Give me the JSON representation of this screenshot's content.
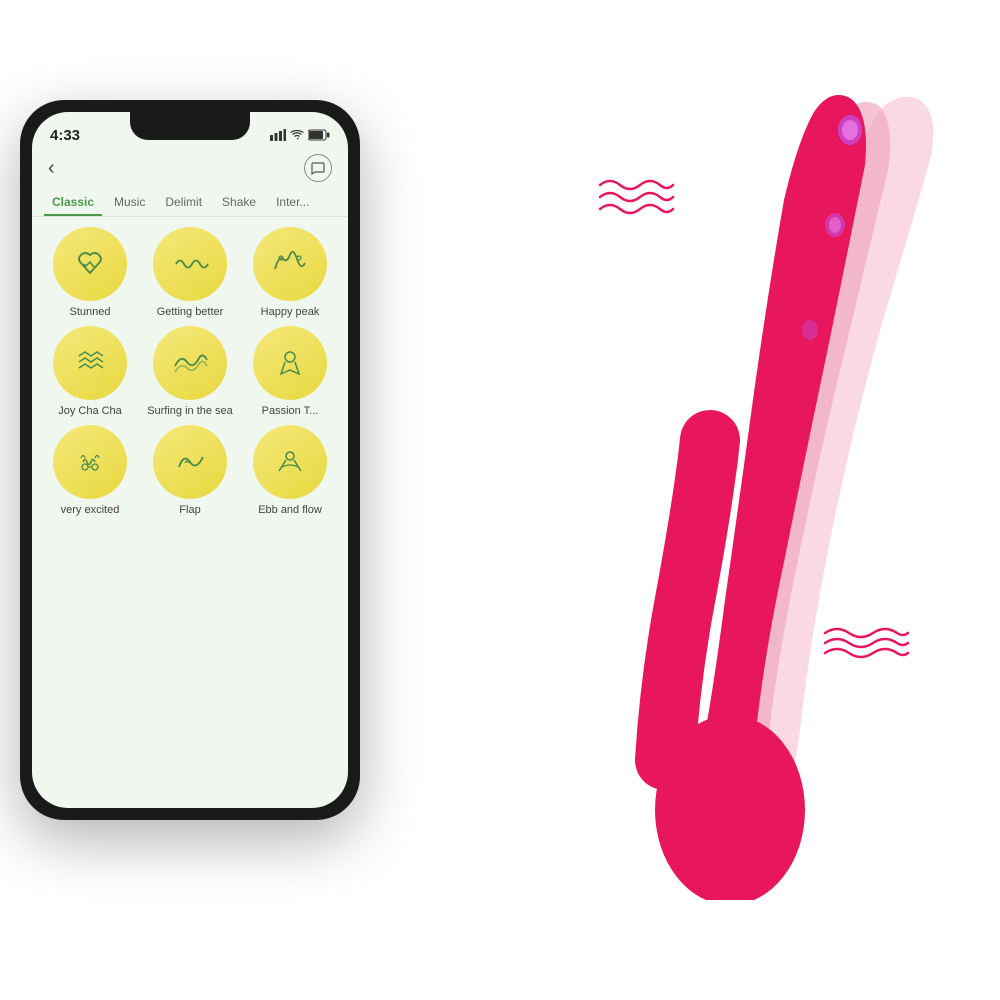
{
  "phone": {
    "status": {
      "time": "4:33",
      "signal": "▲▲▲",
      "wifi": "WiFi",
      "battery": "🔋"
    },
    "tabs": [
      {
        "label": "Classic",
        "active": true
      },
      {
        "label": "Music",
        "active": false
      },
      {
        "label": "Delimit",
        "active": false
      },
      {
        "label": "Shake",
        "active": false
      },
      {
        "label": "Inter...",
        "active": false
      }
    ],
    "modes": [
      {
        "label": "Stunned",
        "icon": "❤️‍🔥"
      },
      {
        "label": "Getting better",
        "icon": "〰️"
      },
      {
        "label": "Happy peak",
        "icon": "🌊"
      },
      {
        "label": "Joy Cha Cha",
        "icon": "✈"
      },
      {
        "label": "Surfing in the sea",
        "icon": "🌊"
      },
      {
        "label": "Passion T...",
        "icon": "🚶"
      },
      {
        "label": "very excited",
        "icon": "💞"
      },
      {
        "label": "Flap",
        "icon": "〰"
      },
      {
        "label": "Ebb and flow",
        "icon": "🏃"
      }
    ]
  },
  "colors": {
    "app_bg": "#f0f7ee",
    "tab_active": "#4a9a4a",
    "circle_bg": "#f0e860",
    "product_main": "#e8175d",
    "product_light": "#f5a0c0",
    "product_lighter": "#f8c8d8"
  }
}
